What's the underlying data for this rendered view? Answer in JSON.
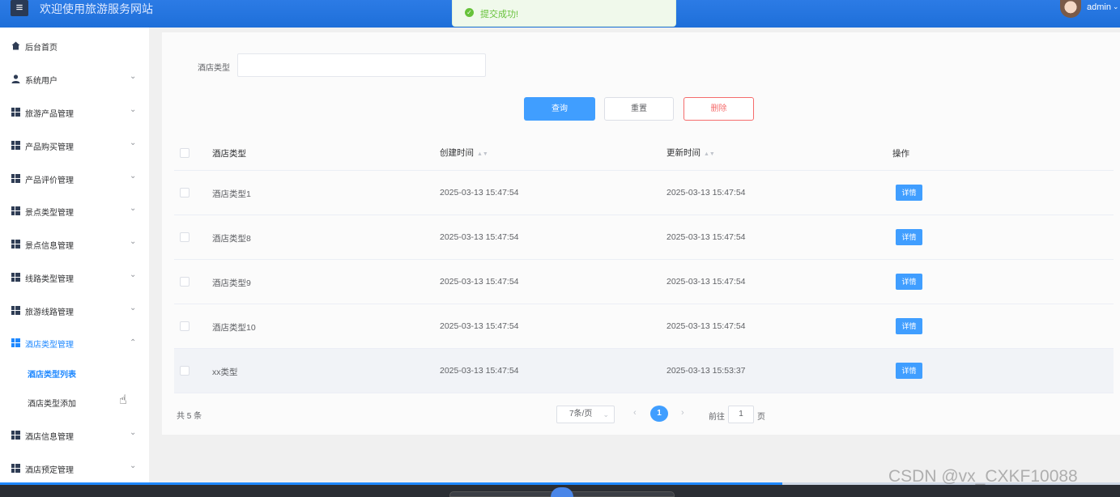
{
  "header": {
    "menu_icon": "menu-icon",
    "title": "欢迎使用旅游服务网站",
    "user": "admin",
    "user_chevron": "⌄"
  },
  "toast": {
    "icon": "check-circle-icon",
    "text": "提交成功!"
  },
  "sidebar": {
    "items": [
      {
        "label": "后台首页",
        "icon": "home-icon"
      },
      {
        "label": "系统用户",
        "icon": "user-icon"
      },
      {
        "label": "旅游产品管理",
        "icon": "grid-icon"
      },
      {
        "label": "产品购买管理",
        "icon": "grid-icon"
      },
      {
        "label": "产品评价管理",
        "icon": "grid-icon"
      },
      {
        "label": "景点类型管理",
        "icon": "grid-icon"
      },
      {
        "label": "景点信息管理",
        "icon": "grid-icon"
      },
      {
        "label": "线路类型管理",
        "icon": "grid-icon"
      },
      {
        "label": "旅游线路管理",
        "icon": "grid-icon"
      },
      {
        "label": "酒店类型管理",
        "icon": "grid-icon",
        "expanded": true
      },
      {
        "label": "酒店信息管理",
        "icon": "grid-icon"
      },
      {
        "label": "酒店预定管理",
        "icon": "grid-icon"
      }
    ],
    "sub_items": [
      {
        "label": "酒店类型列表",
        "active": true
      },
      {
        "label": "酒店类型添加"
      }
    ],
    "active_color": "#1e88ff"
  },
  "search": {
    "label": "酒店类型",
    "value": ""
  },
  "buttons": {
    "query": "查询",
    "reset": "重置",
    "delete": "删除"
  },
  "table": {
    "columns": [
      "酒店类型",
      "创建时间",
      "更新时间",
      "操作"
    ],
    "rows": [
      {
        "type": "酒店类型1",
        "created": "2025-03-13 15:47:54",
        "updated": "2025-03-13 15:47:54",
        "action": "详情"
      },
      {
        "type": "酒店类型8",
        "created": "2025-03-13 15:47:54",
        "updated": "2025-03-13 15:47:54",
        "action": "详情"
      },
      {
        "type": "酒店类型9",
        "created": "2025-03-13 15:47:54",
        "updated": "2025-03-13 15:47:54",
        "action": "详情"
      },
      {
        "type": "酒店类型10",
        "created": "2025-03-13 15:47:54",
        "updated": "2025-03-13 15:47:54",
        "action": "详情"
      },
      {
        "type": "xx类型",
        "created": "2025-03-13 15:47:54",
        "updated": "2025-03-13 15:53:37",
        "action": "详情"
      }
    ]
  },
  "pagination": {
    "total": "共 5 条",
    "page_size": "7条/页",
    "current": "1",
    "goto_prefix": "前往",
    "goto_value": "1",
    "goto_suffix": "页"
  },
  "watermark": "CSDN @vx_CXKF10088",
  "colors": {
    "primary": "#409eff",
    "danger": "#f56c6c",
    "success": "#67c23a",
    "header": "#1e6fd9"
  }
}
